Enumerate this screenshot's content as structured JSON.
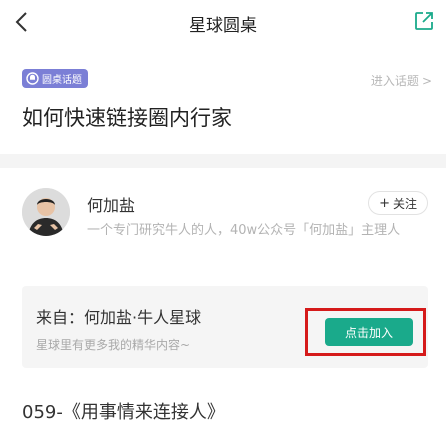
{
  "navbar": {
    "title": "星球圆桌",
    "back_icon": "chevron-left-icon",
    "share_icon": "share-external-icon"
  },
  "topic": {
    "badge_label": "圆桌话题",
    "badge_icon": "roundtable-icon",
    "badge_color": "#7b7fd6",
    "enter_label": "进入话题",
    "enter_chevron": ">",
    "title": "如何快速链接圈内行家"
  },
  "author": {
    "name": "何加盐",
    "follow_label": "关注",
    "follow_plus": "+",
    "bio": "一个专门研究牛人的人，40w公众号「何加盐」主理人"
  },
  "planet": {
    "from_label": "来自：何加盐·牛人星球",
    "desc": "星球里有更多我的精华内容~",
    "join_label": "点击加入",
    "join_color": "#1aaa8b",
    "highlight_color": "#d51a1a"
  },
  "article": {
    "title": "059-《用事情来连接人》"
  }
}
